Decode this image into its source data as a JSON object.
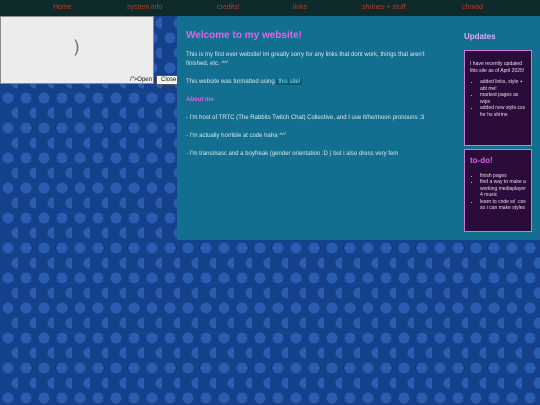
{
  "nav": {
    "items": [
      "Home",
      "system info",
      "credits!",
      "links",
      "shrines + stuff",
      "chmod"
    ]
  },
  "popup": {
    "content_glyph": ")",
    "open_label": "/\">Open",
    "close_label": "Close"
  },
  "main": {
    "title": "Welcome to my website!",
    "intro": "This is my first ever website! im greatly sorry for any links that dont work, things that aren't finished, etc. ^^'",
    "formatted_prefix": "This website was formatted using ",
    "formatted_link": "this site!",
    "about_heading": "About me",
    "about_items": [
      "- I'm host of TRTC (The Rabbits Twitch Chat) Collective, and I use it/he/moon pronouns :3",
      "- I'm actually horrible at code haha ^^'",
      "- I'm transmasc and a boyfreak (gender orientation :D ) but i also dress very fem"
    ]
  },
  "side": {
    "updates_heading": "Updates",
    "updates_text": "I have recently updated this site as of April 2025!",
    "updates_list": [
      "added links, style + abt me!",
      "marked pages as wips",
      "added new style.css for hs shrine"
    ],
    "todo_heading": "to-do!",
    "todo_list": [
      "finish pages",
      "find a way to make a working mediaplayer 4 music",
      "learn to code w/ .css so i can make styles"
    ]
  },
  "colors": {
    "nav_bg": "#0f2a2a",
    "nav_link": "#c0392b",
    "panel": "#136f90",
    "accent_pink": "#e063e8",
    "box_bg": "#2a0b3a"
  }
}
